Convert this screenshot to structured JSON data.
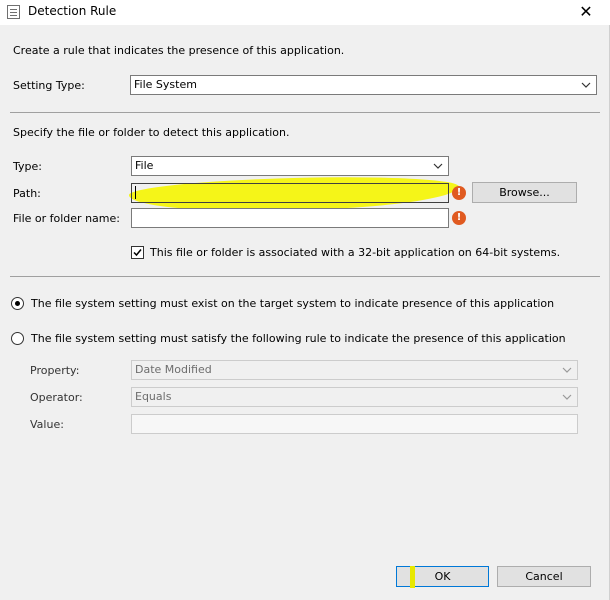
{
  "window": {
    "title": "Detection Rule",
    "close_glyph": "✕"
  },
  "intro_text": "Create a rule that indicates the presence of this application.",
  "setting_type": {
    "label": "Setting Type:",
    "value": "File System"
  },
  "specify_text": "Specify the file or folder to detect this application.",
  "type_field": {
    "label": "Type:",
    "value": "File"
  },
  "path_field": {
    "label": "Path:",
    "value": "",
    "browse_label": "Browse..."
  },
  "name_field": {
    "label": "File or folder name:",
    "value": ""
  },
  "checkbox_32bit": {
    "label": "This file or folder is associated with a 32-bit application on 64-bit systems.",
    "checked": true
  },
  "radio_exist": {
    "label": "The file system setting must exist on the target system to indicate presence of this application",
    "checked": true
  },
  "radio_rule": {
    "label": "The file system setting must satisfy the following rule to indicate the presence of this application",
    "checked": false
  },
  "property_field": {
    "label": "Property:",
    "value": "Date Modified"
  },
  "operator_field": {
    "label": "Operator:",
    "value": "Equals"
  },
  "value_field": {
    "label": "Value:",
    "value": ""
  },
  "buttons": {
    "ok": "OK",
    "cancel": "Cancel"
  },
  "colors": {
    "accent": "#0078d7",
    "highlight": "#f5f500",
    "error": "#e05a20"
  }
}
